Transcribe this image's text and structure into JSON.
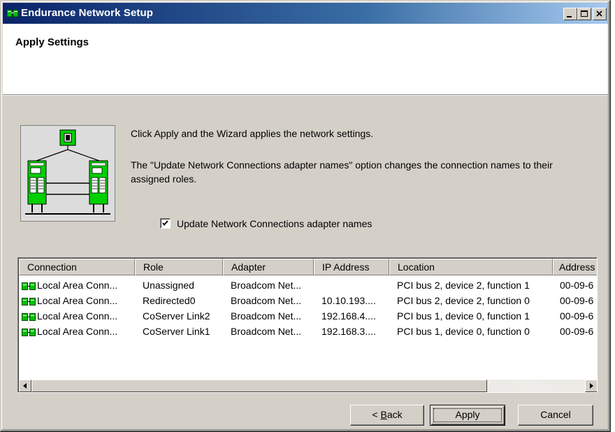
{
  "window": {
    "title": "Endurance Network Setup",
    "controls": [
      "minimize",
      "maximize",
      "close"
    ]
  },
  "header": {
    "title": "Apply Settings"
  },
  "body": {
    "message1": "Click Apply and the Wizard applies the network settings.",
    "message2": "The \"Update Network Connections adapter names\" option changes the connection names to their assigned roles.",
    "checkbox": {
      "label": "Update Network Connections adapter names",
      "checked": true
    }
  },
  "table": {
    "columns": [
      "Connection",
      "Role",
      "Adapter",
      "IP Address",
      "Location",
      "Address"
    ],
    "rows": [
      {
        "connection": "Local Area Conn...",
        "role": "Unassigned",
        "adapter": "Broadcom Net...",
        "ip": "",
        "location": "PCI bus 2, device 2, function 1",
        "address": "00-09-6"
      },
      {
        "connection": "Local Area Conn...",
        "role": "Redirected0",
        "adapter": "Broadcom Net...",
        "ip": "10.10.193....",
        "location": "PCI bus 2, device 2, function 0",
        "address": "00-09-6"
      },
      {
        "connection": "Local Area Conn...",
        "role": "CoServer Link2",
        "adapter": "Broadcom Net...",
        "ip": "192.168.4....",
        "location": "PCI bus 1, device 0, function 1",
        "address": "00-09-6"
      },
      {
        "connection": "Local Area Conn...",
        "role": "CoServer Link1",
        "adapter": "Broadcom Net...",
        "ip": "192.168.3....",
        "location": "PCI bus 1, device 0, function 0",
        "address": "00-09-6"
      }
    ],
    "row_icon": "network-adapter-icon"
  },
  "buttons": {
    "back_prefix": "< ",
    "back_accel": "B",
    "back_rest": "ack",
    "apply": "Apply",
    "cancel": "Cancel"
  },
  "colors": {
    "title_gradient_start": "#0a246a",
    "title_gradient_end": "#a6caf0",
    "dialog_face": "#d4d0c8",
    "network_green": "#00c800"
  }
}
